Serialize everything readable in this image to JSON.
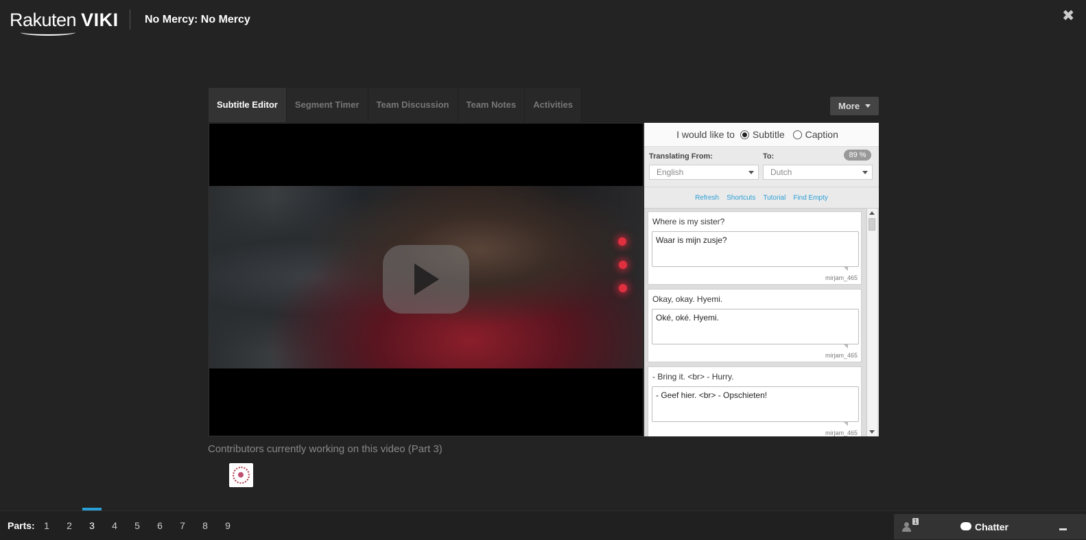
{
  "header": {
    "logo_rakuten": "Rakuten",
    "logo_viki": "VIKI",
    "title": "No Mercy: No Mercy",
    "close_glyph": "✖"
  },
  "tabs": [
    {
      "label": "Subtitle Editor",
      "active": true
    },
    {
      "label": "Segment Timer",
      "active": false
    },
    {
      "label": "Team Discussion",
      "active": false
    },
    {
      "label": "Team Notes",
      "active": false
    },
    {
      "label": "Activities",
      "active": false
    }
  ],
  "more_button": "More",
  "editor": {
    "mode_prompt": "I would like to",
    "mode_options": [
      "Subtitle",
      "Caption"
    ],
    "mode_selected": "Subtitle",
    "translating_from_label": "Translating From:",
    "to_label": "To:",
    "progress": "89 %",
    "from_language": "English",
    "to_language": "Dutch",
    "links": [
      "Refresh",
      "Shortcuts",
      "Tutorial",
      "Find Empty"
    ],
    "segments": [
      {
        "source": "Where is my sister?",
        "translation": "Waar is mijn zusje?",
        "user": "mirjam_465"
      },
      {
        "source": "Okay, okay. Hyemi.",
        "translation": "Oké, oké. Hyemi.",
        "user": "mirjam_465"
      },
      {
        "source": "- Bring it. <br> - Hurry.",
        "translation": "- Geef hier. <br> - Opschieten!",
        "user": "mirjam_465"
      }
    ]
  },
  "contributors_heading": "Contributors currently working on this video (Part 3)",
  "parts": {
    "label": "Parts:",
    "items": [
      "1",
      "2",
      "3",
      "4",
      "5",
      "6",
      "7",
      "8",
      "9"
    ],
    "current": "3"
  },
  "chatter": {
    "online_count": "1",
    "label": "Chatter"
  },
  "colors": {
    "background": "#232323",
    "accent": "#2a9fd6"
  }
}
